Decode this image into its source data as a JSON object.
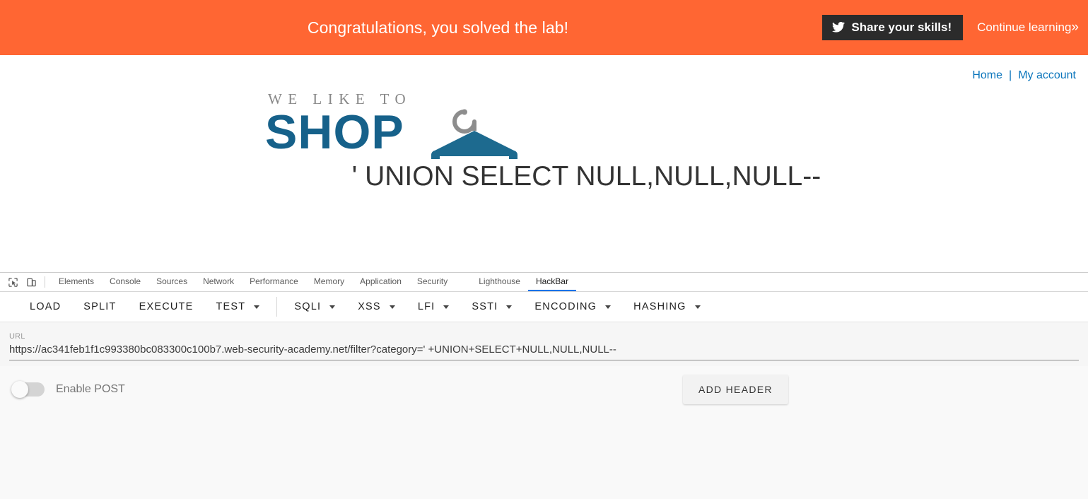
{
  "lab_banner": {
    "title": "Congratulations, you solved the lab!",
    "share_label": "Share your skills!",
    "continue_label": "Continue learning",
    "continue_chevron": "»",
    "background_color": "#ff6633",
    "share_button_color": "#2b2b2b"
  },
  "site": {
    "nav": {
      "home": "Home",
      "separator": "|",
      "my_account": "My account",
      "link_color": "#0b75bc"
    },
    "logo": {
      "tagline": "WE LIKE TO",
      "wordmark": "SHOP",
      "color": "#16618a",
      "tagline_color": "#888888"
    },
    "heading": "' UNION SELECT NULL,NULL,NULL--"
  },
  "devtools": {
    "icons": {
      "inspect": "inspect-element-icon",
      "device": "device-toolbar-icon"
    },
    "tabs": [
      {
        "label": "Elements",
        "active": false
      },
      {
        "label": "Console",
        "active": false
      },
      {
        "label": "Sources",
        "active": false
      },
      {
        "label": "Network",
        "active": false
      },
      {
        "label": "Performance",
        "active": false
      },
      {
        "label": "Memory",
        "active": false
      },
      {
        "label": "Application",
        "active": false
      },
      {
        "label": "Security",
        "active": false
      },
      {
        "label": "Lighthouse",
        "active": false
      },
      {
        "label": "HackBar",
        "active": true
      }
    ],
    "active_tab_color": "#1a73e8"
  },
  "hackbar": {
    "toolbar": [
      {
        "label": "LOAD",
        "has_dropdown": false
      },
      {
        "label": "SPLIT",
        "has_dropdown": false
      },
      {
        "label": "EXECUTE",
        "has_dropdown": false
      },
      {
        "label": "TEST",
        "has_dropdown": true
      },
      {
        "label": "SQLI",
        "has_dropdown": true
      },
      {
        "label": "XSS",
        "has_dropdown": true
      },
      {
        "label": "LFI",
        "has_dropdown": true
      },
      {
        "label": "SSTI",
        "has_dropdown": true
      },
      {
        "label": "ENCODING",
        "has_dropdown": true
      },
      {
        "label": "HASHING",
        "has_dropdown": true
      }
    ],
    "url": {
      "label": "URL",
      "value": "https://ac341feb1f1c993380bc083300c100b7.web-security-academy.net/filter?category=' +UNION+SELECT+NULL,NULL,NULL--",
      "placeholder": ""
    },
    "enable_post": {
      "label": "Enable POST",
      "state": "off"
    },
    "add_header_label": "ADD HEADER"
  }
}
